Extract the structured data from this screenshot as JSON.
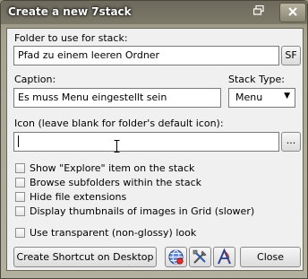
{
  "window": {
    "title": "Create a new 7stack"
  },
  "folder": {
    "label": "Folder to use for stack:",
    "value": "Pfad zu einem leeren Ordner",
    "sf_label": "SF",
    "browse_label": "..."
  },
  "caption": {
    "label": "Caption:",
    "value": "Es muss Menu eingestellt sein"
  },
  "stack_type": {
    "label": "Stack Type:",
    "value": "Menu"
  },
  "icon": {
    "label": "Icon (leave blank for folder's default icon):",
    "value": "",
    "browse_label": "..."
  },
  "options": [
    {
      "label": "Show \"Explore\" item on the stack",
      "checked": false
    },
    {
      "label": "Browse subfolders within the stack",
      "checked": false
    },
    {
      "label": "Hide file extensions",
      "checked": false
    },
    {
      "label": "Display thumbnails of images in Grid (slower)",
      "checked": false
    }
  ],
  "transparent": {
    "label": "Use transparent (non-glossy) look",
    "checked": false
  },
  "buttons": {
    "create_shortcut": "Create Shortcut on Desktop",
    "close": "Close"
  },
  "icons": {
    "restore": "restore-icon",
    "close": "close-icon",
    "globe": "globe-icon",
    "tools": "tools-icon",
    "letter_a": "letter-a-icon"
  }
}
